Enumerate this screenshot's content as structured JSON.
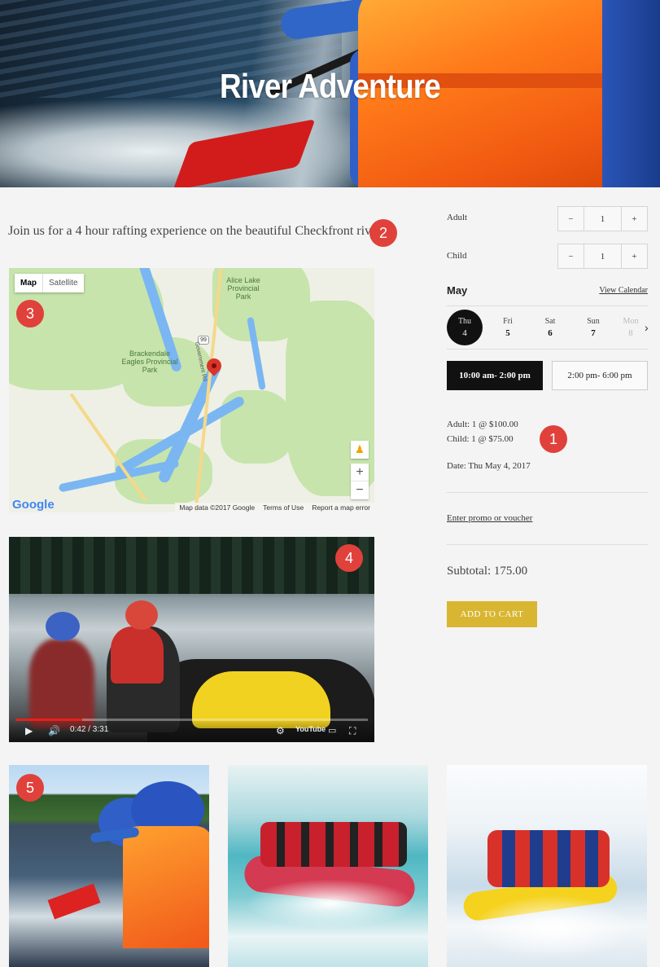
{
  "hero": {
    "title": "River Adventure"
  },
  "intro": {
    "text": "Join us for a 4 hour rafting experience on the beautiful Checkfront river."
  },
  "badges": [
    "1",
    "2",
    "3",
    "4",
    "5"
  ],
  "map": {
    "tabs": [
      "Map",
      "Satellite"
    ],
    "places": [
      "Alice Lake Provincial Park",
      "Brackendale Eagles Provincial Park"
    ],
    "road_label": "99",
    "road_name": "Government Rd",
    "footer": [
      "Map data ©2017 Google",
      "Terms of Use",
      "Report a map error"
    ],
    "logo": "Google",
    "zoom_in": "+",
    "zoom_out": "−"
  },
  "video": {
    "time": "0:42 / 3:31",
    "progress_fraction": 0.19,
    "brand": "YouTube"
  },
  "booking": {
    "adult_label": "Adult",
    "adult_qty": "1",
    "child_label": "Child",
    "child_qty": "1",
    "minus": "−",
    "plus": "+",
    "month": "May",
    "view_calendar": "View Calendar",
    "days": [
      {
        "name": "Thu",
        "num": "4"
      },
      {
        "name": "Fri",
        "num": "5"
      },
      {
        "name": "Sat",
        "num": "6"
      },
      {
        "name": "Sun",
        "num": "7"
      },
      {
        "name": "Mon",
        "num": "8"
      }
    ],
    "slots": [
      "10:00 am- 2:00 pm",
      "2:00 pm- 6:00 pm"
    ],
    "summary_adult": "Adult: 1 @ $100.00",
    "summary_child": "Child: 1 @ $75.00",
    "summary_date": "Date: Thu May 4, 2017",
    "promo": "Enter promo or voucher",
    "subtotal": "Subtotal: 175.00",
    "add_to_cart": "ADD TO CART"
  },
  "colors": {
    "badge": "#e0413b",
    "cart_button": "#d9b632",
    "selected": "#111111"
  }
}
